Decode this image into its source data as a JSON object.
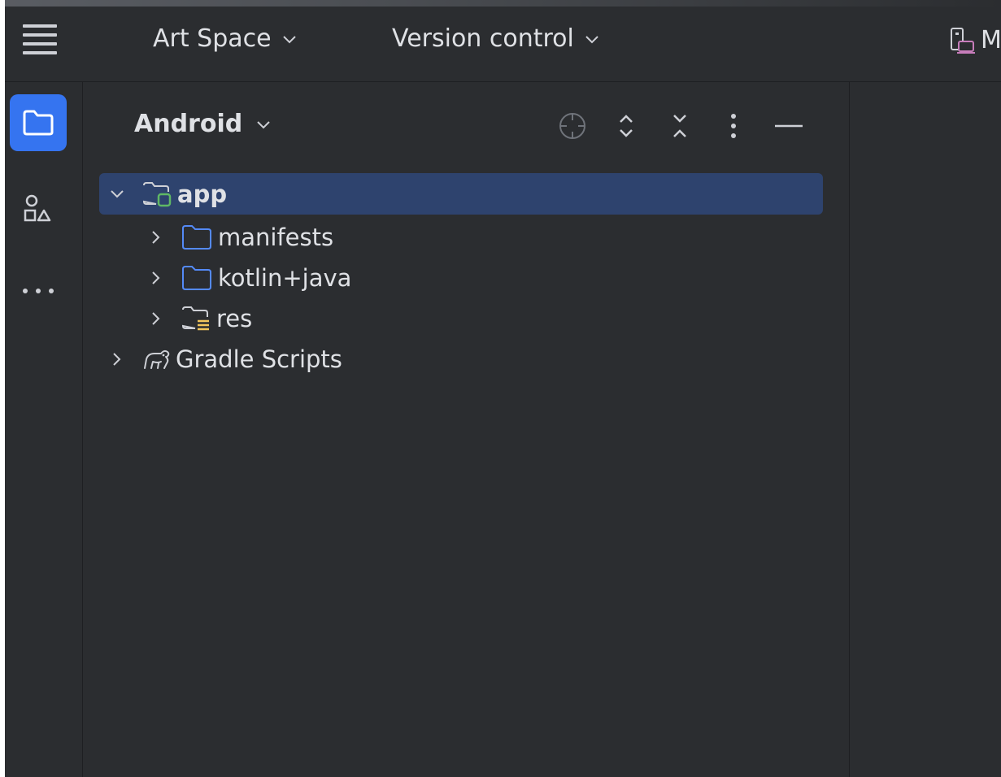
{
  "toolbar": {
    "menu_icon": "hamburger-menu-icon",
    "project_name": "Art Space",
    "version_control": "Version control",
    "device_label": "M"
  },
  "stripe": {
    "items": [
      {
        "name": "project",
        "icon": "folder-icon",
        "active": true
      },
      {
        "name": "resource-manager",
        "icon": "shapes-icon",
        "active": false
      },
      {
        "name": "more",
        "icon": "more-horizontal-icon",
        "active": false
      }
    ]
  },
  "panel": {
    "view_title": "Android",
    "actions": [
      "crosshair-icon",
      "expand-all-icon",
      "collapse-all-icon",
      "more-vertical-icon",
      "hide-icon"
    ]
  },
  "tree": [
    {
      "label": "app",
      "expanded": true,
      "selected": true,
      "bold": true,
      "icon": "module-folder-icon"
    },
    {
      "label": "manifests",
      "expanded": false,
      "icon": "folder-icon"
    },
    {
      "label": "kotlin+java",
      "expanded": false,
      "icon": "folder-icon"
    },
    {
      "label": "res",
      "expanded": false,
      "icon": "resource-folder-icon"
    },
    {
      "label": "Gradle Scripts",
      "expanded": false,
      "icon": "gradle-elephant-icon"
    }
  ],
  "colors": {
    "background": "#2b2d30",
    "accent": "#3574f0",
    "selection": "#2e436e",
    "folder_blue": "#548af7",
    "module_green": "#5fb865",
    "resource_yellow": "#f2c55c",
    "device_purple": "#c77dbb"
  }
}
